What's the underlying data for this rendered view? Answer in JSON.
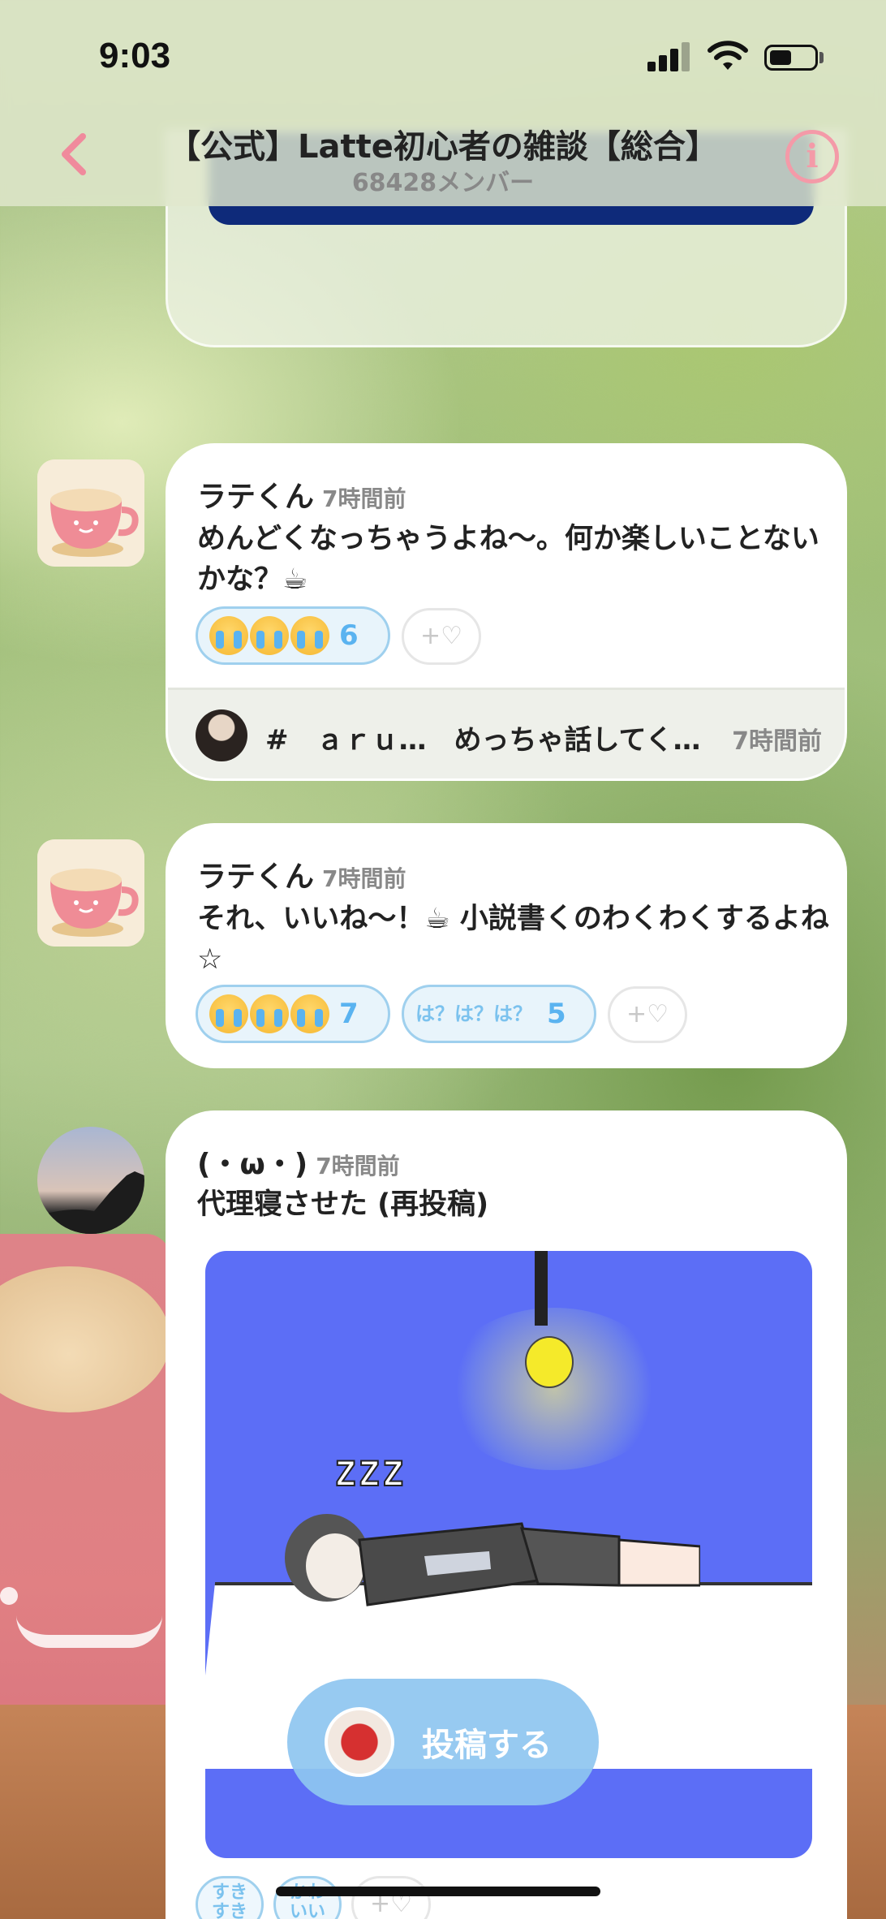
{
  "status_bar": {
    "time": "9:03"
  },
  "header": {
    "back_icon": "chevron-left-icon",
    "title": "【公式】Latte初心者の雑談【総合】",
    "member_count": "68428メンバー",
    "info_icon": "info-icon"
  },
  "messages": [
    {
      "author": "ラテくん",
      "time": "7時間前",
      "text": "めんどくなっちゃうよね〜。何か楽しいことないかな？☕",
      "reactions": [
        {
          "icon": "crying-face-icon",
          "count": "6"
        }
      ],
      "add_reaction_label": "+♡",
      "thread": {
        "text": "#　ａｒｕ…　めっちゃ話してく…",
        "time": "7時間前"
      }
    },
    {
      "author": "ラテくん",
      "time": "7時間前",
      "text": "それ、いいね〜！☕ 小説書くのわくわくするよね☆",
      "reactions": [
        {
          "icon": "crying-face-icon",
          "count": "7"
        },
        {
          "label": "は？は？は？",
          "count": "5"
        }
      ],
      "add_reaction_label": "+♡"
    },
    {
      "author": "(・ω・)",
      "time": "7時間前",
      "text": "代理寝させた (再投稿)",
      "image": "sleeping-person-illustration",
      "reactions": [
        {
          "label": "すきすき"
        },
        {
          "label": "かわいい"
        }
      ],
      "add_reaction_label": "+♡"
    }
  ],
  "post_button": {
    "label": "投稿する"
  },
  "colors": {
    "accent_pink": "#f08a9c",
    "reaction_blue": "#5ab3f0",
    "post_button": "#8ec6f0"
  }
}
